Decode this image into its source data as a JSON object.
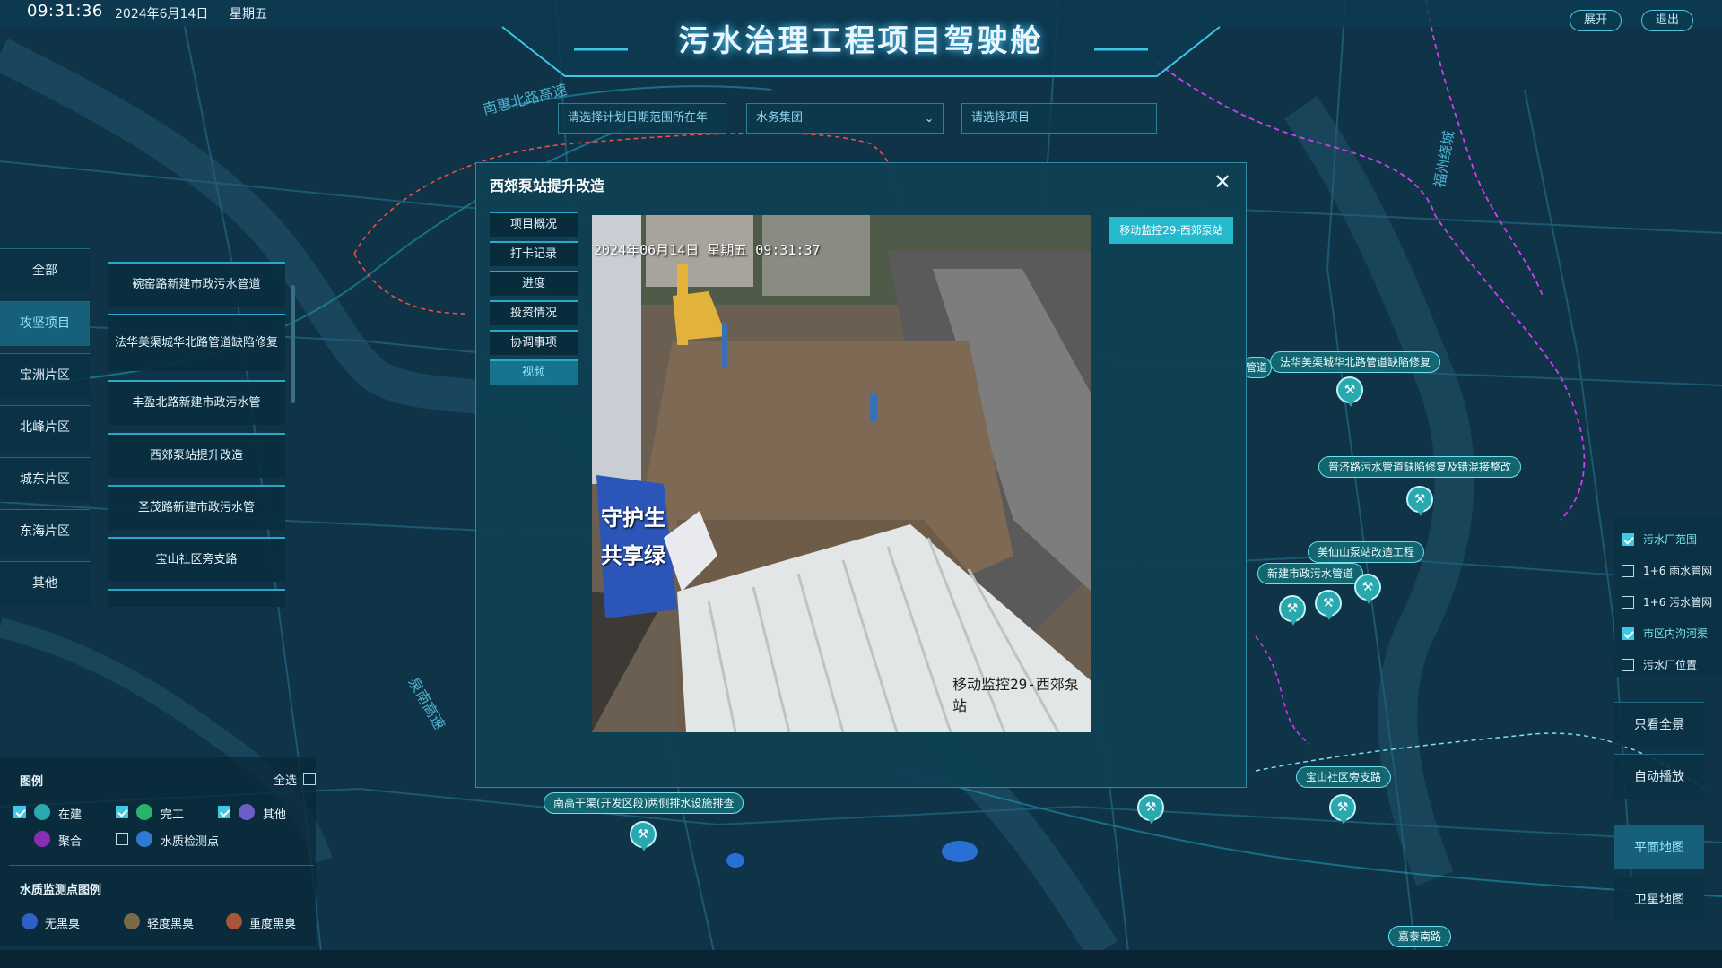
{
  "header": {
    "time": "09:31:36",
    "date": "2024年6月14日",
    "weekday": "星期五",
    "title": "污水治理工程项目驾驶舱",
    "expand_label": "展开",
    "exit_label": "退出"
  },
  "filters": {
    "date_placeholder": "请选择计划日期范围所在年",
    "group_value": "水务集团",
    "project_placeholder": "请选择项目"
  },
  "categories": [
    "全部",
    "攻坚项目",
    "宝洲片区",
    "北峰片区",
    "城东片区",
    "东海片区",
    "其他"
  ],
  "projects": [
    "碗窑路新建市政污水管道",
    "法华美渠城华北路管道缺陷修复",
    "丰盈北路新建市政污水管",
    "西郊泵站提升改造",
    "圣茂路新建市政污水管",
    "宝山社区旁支路"
  ],
  "legend": {
    "title": "图例",
    "select_all": "全选",
    "items": [
      {
        "label": "在建",
        "checked": true,
        "color": "#2aa8b0"
      },
      {
        "label": "完工",
        "checked": true,
        "color": "#27b36a"
      },
      {
        "label": "其他",
        "checked": true,
        "color": "#6b5fc7"
      },
      {
        "label": "聚合",
        "color": "#8a2db5"
      },
      {
        "label": "水质检测点",
        "checked": false,
        "color": "#2f7ad0"
      }
    ],
    "water_title": "水质监测点图例",
    "water_items": [
      {
        "label": "无黑臭",
        "color": "#2f5fc8"
      },
      {
        "label": "轻度黑臭",
        "color": "#7a6a4a"
      },
      {
        "label": "重度黑臭",
        "color": "#a8553a"
      }
    ]
  },
  "right_panel": {
    "layers": [
      {
        "label": "污水厂范围",
        "checked": true
      },
      {
        "label": "1+6 雨水管网",
        "checked": false
      },
      {
        "label": "1+6 污水管网",
        "checked": false
      },
      {
        "label": "市区内沟河渠",
        "checked": true
      },
      {
        "label": "污水厂位置",
        "checked": false
      }
    ],
    "buttons": [
      "只看全景",
      "自动播放",
      "平面地图",
      "卫星地图"
    ]
  },
  "map_labels": [
    "法华美渠城华北路管道缺陷修复",
    "普济路污水管道缺陷修复及错混接整改",
    "美仙山泵站改造工程",
    "新建市政污水管道",
    "宝山社区旁支路",
    "南高干渠(开发区段)两侧排水设施排查",
    "嘉泰南路",
    "管道"
  ],
  "road_names": [
    "南惠北路高速",
    "泉南高速",
    "福州绕城"
  ],
  "modal": {
    "title": "西郊泵站提升改造",
    "close_icon": "close-icon",
    "tabs": [
      "项目概况",
      "打卡记录",
      "进度",
      "投资情况",
      "协调事项",
      "视频"
    ],
    "active_tab": "视频",
    "camera_button": "移动监控29-西郊泵站",
    "video": {
      "timestamp": "2024年06月14日 星期五 09:31:37",
      "caption": "移动监控29-西郊泵站",
      "sign_text_1": "守护生",
      "sign_text_2": "共享绿"
    }
  }
}
